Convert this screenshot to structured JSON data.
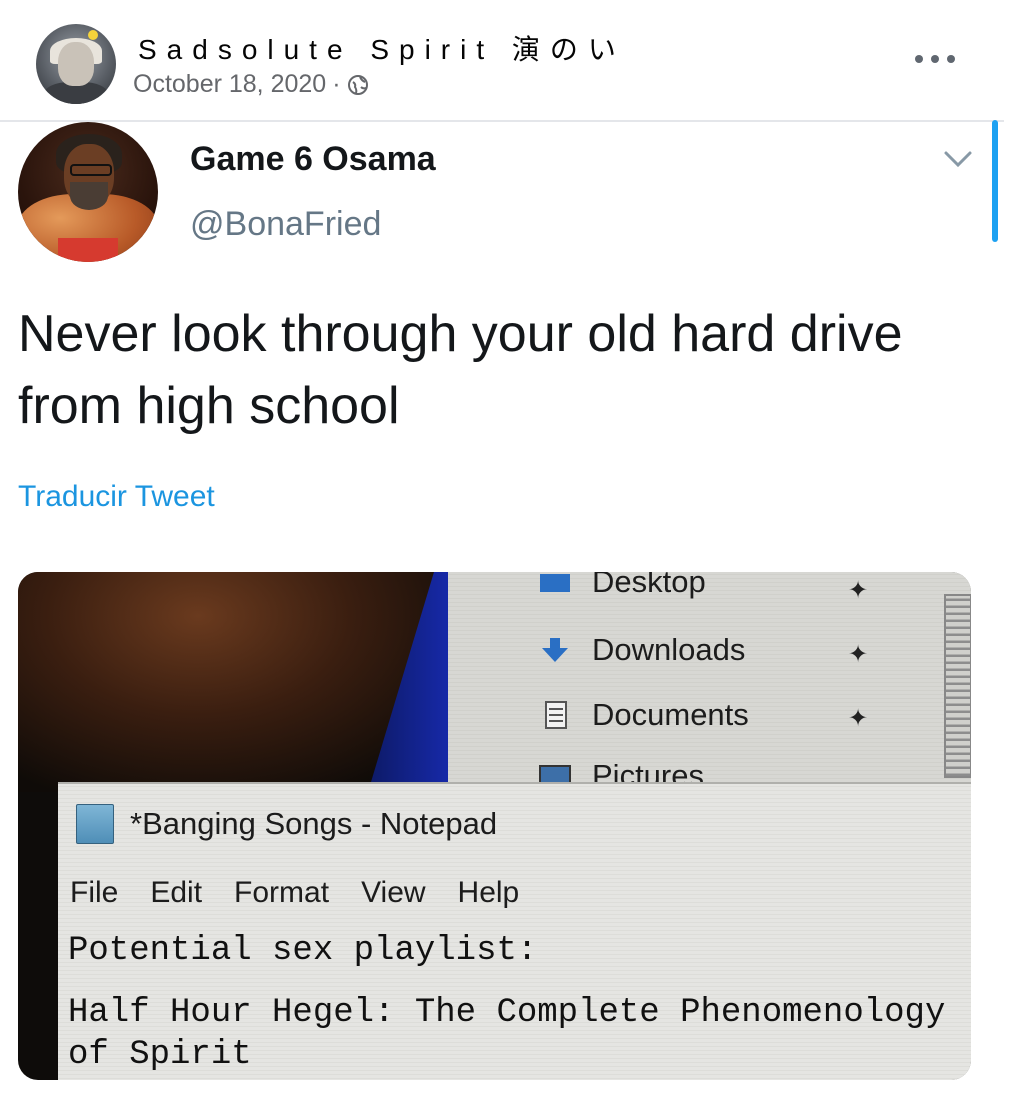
{
  "post": {
    "author": "Sadsolute Spirit 演のい",
    "date": "October 18, 2020",
    "date_sep": "·",
    "icons": {
      "privacy": "globe-icon",
      "more": "more-options-icon"
    }
  },
  "tweet": {
    "display_name": "Game 6 Osama",
    "handle": "@BonaFried",
    "text": "Never look through your old hard drive from high school",
    "translate_label": "Traducir Tweet",
    "colors": {
      "link": "#1b95e0",
      "handle": "#657786",
      "accent": "#1da1f2"
    }
  },
  "media": {
    "explorer_quick_access": [
      {
        "label": "Desktop",
        "icon": "desktop-folder-icon"
      },
      {
        "label": "Downloads",
        "icon": "download-arrow-icon"
      },
      {
        "label": "Documents",
        "icon": "documents-icon"
      },
      {
        "label": "Pictures",
        "icon": "pictures-icon"
      }
    ],
    "notepad": {
      "title": "*Banging Songs - Notepad",
      "menu": [
        "File",
        "Edit",
        "Format",
        "View",
        "Help"
      ],
      "line1": "Potential sex playlist:",
      "line2": "Half Hour Hegel: The Complete Phenomenology",
      "line3": "of Spirit"
    }
  }
}
